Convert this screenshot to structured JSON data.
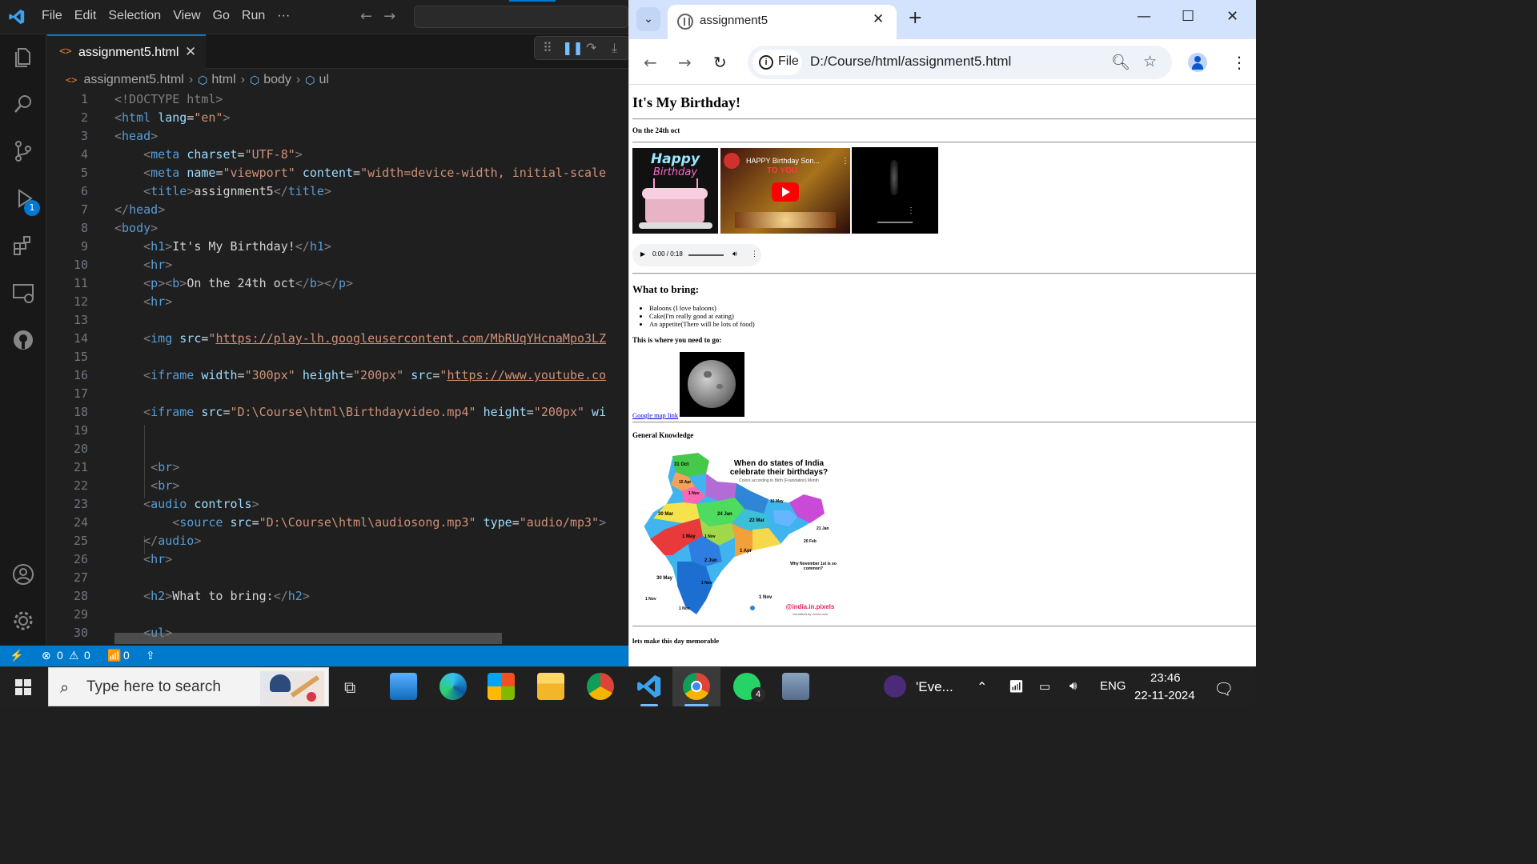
{
  "vscode": {
    "menu": [
      "File",
      "Edit",
      "Selection",
      "View",
      "Go",
      "Run",
      "···"
    ],
    "debug_badge": "1",
    "tab": {
      "label": "assignment5.html",
      "close": "✕"
    },
    "breadcrumb": [
      "assignment5.html",
      "html",
      "body",
      "ul"
    ],
    "code_lines": [
      {
        "n": "1"
      },
      {
        "n": "2"
      },
      {
        "n": "3"
      },
      {
        "n": "4"
      },
      {
        "n": "5"
      },
      {
        "n": "6"
      },
      {
        "n": "7"
      },
      {
        "n": "8"
      },
      {
        "n": "9"
      },
      {
        "n": "10"
      },
      {
        "n": "11"
      },
      {
        "n": "12"
      },
      {
        "n": "13"
      },
      {
        "n": "14"
      },
      {
        "n": "15"
      },
      {
        "n": "16"
      },
      {
        "n": "17"
      },
      {
        "n": "18"
      },
      {
        "n": "19"
      },
      {
        "n": "20"
      },
      {
        "n": "21"
      },
      {
        "n": "22"
      },
      {
        "n": "23"
      },
      {
        "n": "24"
      },
      {
        "n": "25"
      },
      {
        "n": "26"
      },
      {
        "n": "27"
      },
      {
        "n": "28"
      },
      {
        "n": "29"
      },
      {
        "n": "30"
      }
    ],
    "code_text": {
      "l1": "<!DOCTYPE html>",
      "l2_lang": "\"en\"",
      "l4_charset": "\"UTF-8\"",
      "l5_name": "\"viewport\"",
      "l5_content": "\"width=device-width, initial-scale",
      "l6_title": "assignment5",
      "l9_h1": "It's My Birthday!",
      "l11_b": "On the 24th oct",
      "l14_src": "https://play-lh.googleusercontent.com/MbRUqYHcnaMpo3LZ",
      "l16_width": "\"300px\"",
      "l16_height": "\"200px\"",
      "l16_src": "https://www.youtube.co",
      "l18_src": "\"D:\\Course\\html\\Birthdayvideo.mp4\"",
      "l18_height": "\"200px\"",
      "l18_tail": "wi",
      "l24_src": "\"D:\\Course\\html\\audiosong.mp3\"",
      "l24_type": "\"audio/mp3\"",
      "l28_h2": "What to bring:"
    },
    "status": {
      "errors": "0",
      "warnings": "0",
      "ports": "0"
    }
  },
  "chrome": {
    "tab_title": "assignment5",
    "tab_close": "✕",
    "new_tab": "+",
    "scheme_chip": "File",
    "url": "D:/Course/html/assignment5.html",
    "window_controls": [
      "—",
      "☐",
      "✕"
    ]
  },
  "page": {
    "h1": "It's My Birthday!",
    "date": "On the 24th oct",
    "image_text": [
      "Happy",
      "Birthday"
    ],
    "video_title": "HAPPY Birthday Son...",
    "video_overlay": "TO YOU",
    "audio_time": "0:00 / 0:18",
    "h2": "What to bring:",
    "bring_items": [
      "Baloons (I love baloons)",
      "Cake(I'm really good at eating)",
      "An appetite(There will be lots of food)"
    ],
    "where": "This is where you need to go:",
    "map_link": "Google map link",
    "gk": "General Knowledge",
    "map_title": "When do states of India celebrate their birthdays?",
    "map_subtitle": "Colors according to Birth (Foundation) Month",
    "map_credit": "@india.in.pixels",
    "map_credit_sub": "Visualised by xxxvis.com",
    "map_note_title": "Why November 1st is so common?",
    "map_labels": [
      "31 Oct",
      "15 Apr",
      "1 Nov",
      "30 Mar",
      "24 Jan",
      "22 Mar",
      "1 May",
      "1 Nov",
      "1 Apr",
      "2 Jun",
      "30 May",
      "1 Nov",
      "1 Nov",
      "1 Nov",
      "16 May",
      "21 Jan",
      "20 Feb",
      "1 Nov"
    ],
    "footer": "lets make this day memorable"
  },
  "taskbar": {
    "search_placeholder": "Type here to search",
    "whatsapp_badge": "4",
    "news": "'Eve...",
    "lang": "ENG",
    "time": "23:46",
    "date": "22-11-2024"
  }
}
